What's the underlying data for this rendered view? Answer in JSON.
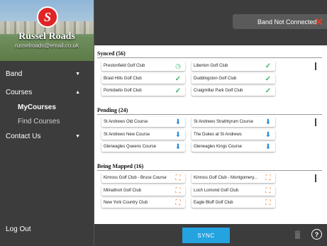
{
  "profile": {
    "name": "Russel Roads",
    "email": "russelroads@email.co.uk",
    "logo_letter": "S"
  },
  "nav": {
    "band_label": "Band",
    "courses_label": "Courses",
    "my_courses_label": "MyCourses",
    "find_courses_label": "Find Courses",
    "contact_label": "Contact Us",
    "logout_label": "Log Out"
  },
  "header": {
    "connection_status": "Band Not Connected"
  },
  "sections": {
    "synced": {
      "title": "Synced (56)",
      "courses": [
        {
          "name": "Prestonfield Golf Club",
          "icon": "clock-icon"
        },
        {
          "name": "Liberton Golf Club",
          "icon": "check-icon"
        },
        {
          "name": "Braid Hills Golf Club",
          "icon": "check-icon"
        },
        {
          "name": "Duddingston Golf Club",
          "icon": "check-icon"
        },
        {
          "name": "Portobello Golf Club",
          "icon": "check-icon"
        },
        {
          "name": "Craigmillar Park Golf Club",
          "icon": "check-icon"
        }
      ]
    },
    "pending": {
      "title": "Pending (24)",
      "courses": [
        {
          "name": "St Andrews Old Course",
          "icon": "download-icon"
        },
        {
          "name": "St Andrews Strathtyrum Course",
          "icon": "download-icon"
        },
        {
          "name": "St Andrews New Course",
          "icon": "download-icon"
        },
        {
          "name": "The Dukes at St Andrews",
          "icon": "download-icon"
        },
        {
          "name": "Gleneagles Queens Course",
          "icon": "download-icon"
        },
        {
          "name": "Gleneagles Kings Course",
          "icon": "download-icon"
        }
      ]
    },
    "mapped": {
      "title": "Being Mapped (16)",
      "courses": [
        {
          "name": "Kinross Golf Club - Bruce Course",
          "icon": "map-icon"
        },
        {
          "name": "Kinross Golf Club - Montgomery...",
          "icon": "map-icon"
        },
        {
          "name": "Milnathort Golf Club",
          "icon": "map-icon"
        },
        {
          "name": "Loch Lomond Golf Club",
          "icon": "map-icon"
        },
        {
          "name": "New York Country Club",
          "icon": "map-icon"
        },
        {
          "name": "Eagle Bluff Golf Club",
          "icon": "map-icon"
        }
      ]
    }
  },
  "footer": {
    "sync_label": "SYNC",
    "help_label": "?"
  },
  "colors": {
    "accent": "#23a3e0",
    "check": "#3cb371",
    "download": "#2d8bd6",
    "mapping": "#f08030",
    "error": "#e04020"
  }
}
